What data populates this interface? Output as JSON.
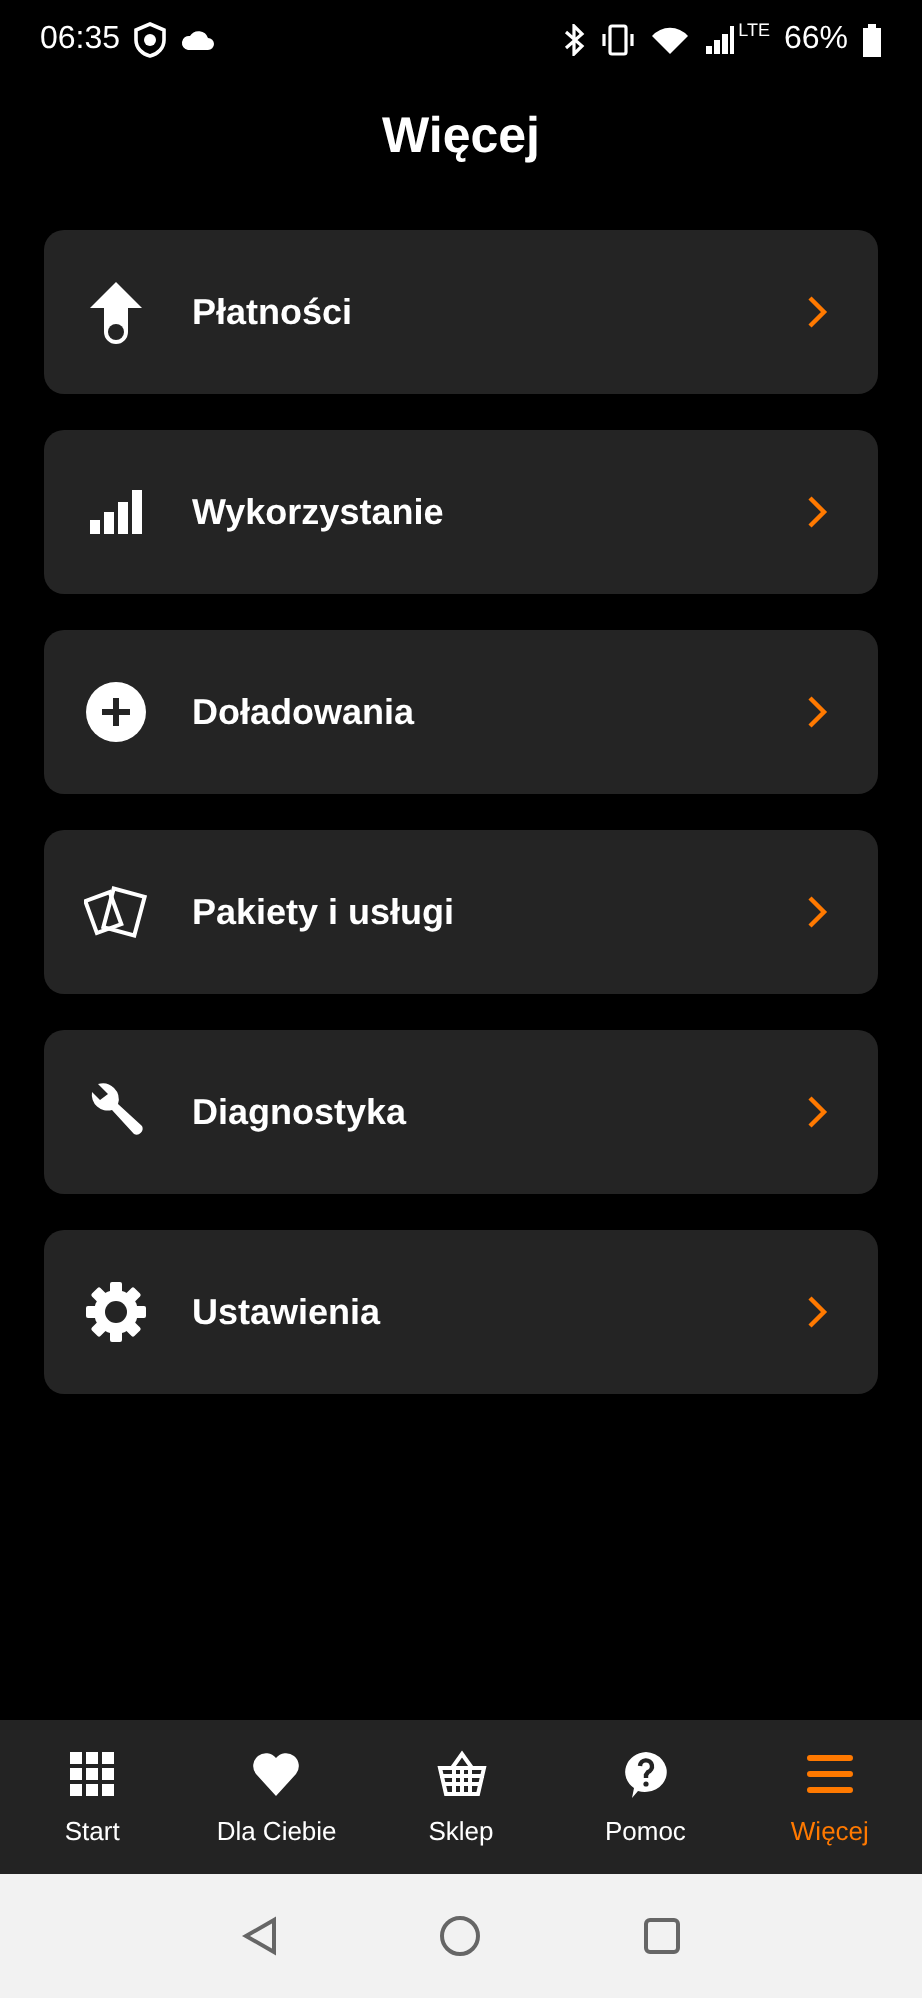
{
  "status_bar": {
    "time": "06:35",
    "network": "LTE",
    "battery": "66%"
  },
  "title": "Więcej",
  "menu": [
    {
      "kind": "payment",
      "label": "Płatności"
    },
    {
      "kind": "usage",
      "label": "Wykorzystanie"
    },
    {
      "kind": "topup",
      "label": "Doładowania"
    },
    {
      "kind": "packages",
      "label": "Pakiety i usługi"
    },
    {
      "kind": "diagnostics",
      "label": "Diagnostyka"
    },
    {
      "kind": "settings",
      "label": "Ustawienia"
    }
  ],
  "tab_bar": [
    {
      "kind": "grid",
      "label": "Start",
      "selected": false
    },
    {
      "kind": "heart",
      "label": "Dla Ciebie",
      "selected": false
    },
    {
      "kind": "basket",
      "label": "Sklep",
      "selected": false
    },
    {
      "kind": "help",
      "label": "Pomoc",
      "selected": false
    },
    {
      "kind": "menu",
      "label": "Więcej",
      "selected": true
    }
  ]
}
